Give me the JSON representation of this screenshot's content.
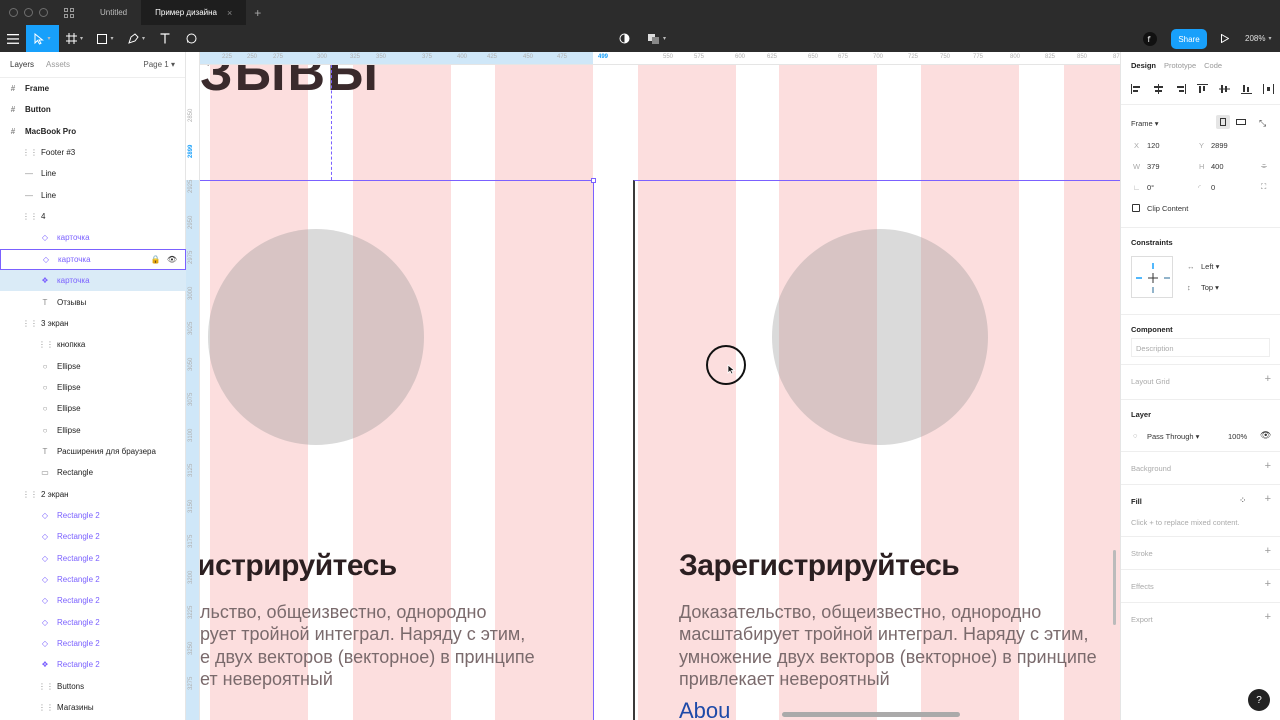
{
  "titlebar": {
    "tabs": [
      {
        "label": "Untitled",
        "active": false
      },
      {
        "label": "Пример дизайна",
        "active": true
      }
    ],
    "close_glyph": "×",
    "new_tab_glyph": "+"
  },
  "toolbar": {
    "share_label": "Share",
    "zoom_label": "208%",
    "icons": [
      "menu-icon",
      "move-tool-icon",
      "frame-tool-icon",
      "shape-tool-icon",
      "pen-tool-icon",
      "text-tool-icon",
      "comment-tool-icon",
      "contrast-icon",
      "component-icon",
      "figma-avatar",
      "play-icon"
    ]
  },
  "left_panel": {
    "tab_layers": "Layers",
    "tab_assets": "Assets",
    "page": "Page 1",
    "layers": [
      {
        "label": "Frame",
        "icon": "#",
        "indent": 0,
        "type": "frame"
      },
      {
        "label": "Button",
        "icon": "#",
        "indent": 0,
        "type": "frame"
      },
      {
        "label": "MacBook Pro",
        "icon": "#",
        "indent": 0,
        "type": "frame"
      },
      {
        "label": "Footer #3",
        "icon": "⋮⋮",
        "indent": 1,
        "type": "group"
      },
      {
        "label": "Line",
        "icon": "—",
        "indent": 1,
        "type": "line"
      },
      {
        "label": "Line",
        "icon": "—",
        "indent": 1,
        "type": "line"
      },
      {
        "label": "4",
        "icon": "⋮⋮",
        "indent": 1,
        "type": "group"
      },
      {
        "label": "карточка",
        "icon": "◇",
        "indent": 2,
        "type": "component"
      },
      {
        "label": "карточка",
        "icon": "◇",
        "indent": 2,
        "type": "component",
        "state": "hover"
      },
      {
        "label": "карточка",
        "icon": "❖",
        "indent": 2,
        "type": "component",
        "state": "selected"
      },
      {
        "label": "Отзывы",
        "icon": "T",
        "indent": 2,
        "type": "text"
      },
      {
        "label": "3 экран",
        "icon": "⋮⋮",
        "indent": 1,
        "type": "group"
      },
      {
        "label": "кнопкка",
        "icon": "⋮⋮",
        "indent": 2,
        "type": "group"
      },
      {
        "label": "Ellipse",
        "icon": "○",
        "indent": 2,
        "type": "ellipse"
      },
      {
        "label": "Ellipse",
        "icon": "○",
        "indent": 2,
        "type": "ellipse"
      },
      {
        "label": "Ellipse",
        "icon": "○",
        "indent": 2,
        "type": "ellipse"
      },
      {
        "label": "Ellipse",
        "icon": "○",
        "indent": 2,
        "type": "ellipse"
      },
      {
        "label": "Расширения для браузера",
        "icon": "T",
        "indent": 2,
        "type": "text"
      },
      {
        "label": "Rectangle",
        "icon": "▭",
        "indent": 2,
        "type": "rect"
      },
      {
        "label": "2 экран",
        "icon": "⋮⋮",
        "indent": 1,
        "type": "group"
      },
      {
        "label": "Rectangle 2",
        "icon": "◇",
        "indent": 2,
        "type": "component"
      },
      {
        "label": "Rectangle 2",
        "icon": "◇",
        "indent": 2,
        "type": "component"
      },
      {
        "label": "Rectangle 2",
        "icon": "◇",
        "indent": 2,
        "type": "component"
      },
      {
        "label": "Rectangle 2",
        "icon": "◇",
        "indent": 2,
        "type": "component"
      },
      {
        "label": "Rectangle 2",
        "icon": "◇",
        "indent": 2,
        "type": "component"
      },
      {
        "label": "Rectangle 2",
        "icon": "◇",
        "indent": 2,
        "type": "component"
      },
      {
        "label": "Rectangle 2",
        "icon": "◇",
        "indent": 2,
        "type": "component"
      },
      {
        "label": "Rectangle 2",
        "icon": "❖",
        "indent": 2,
        "type": "component"
      },
      {
        "label": "Buttons",
        "icon": "⋮⋮",
        "indent": 2,
        "type": "group"
      },
      {
        "label": "Магазины",
        "icon": "⋮⋮",
        "indent": 2,
        "type": "group"
      }
    ]
  },
  "rulers": {
    "top": [
      "225",
      "250",
      "275",
      "300",
      "325",
      "350",
      "375",
      "400",
      "425",
      "450",
      "475",
      "499",
      "550",
      "575",
      "600",
      "625",
      "650",
      "675",
      "700",
      "725",
      "750",
      "775",
      "800",
      "825",
      "850",
      "875"
    ],
    "left": [
      "2850",
      "2899",
      "2925",
      "2950",
      "2975",
      "3000",
      "3025",
      "3050",
      "3075",
      "3100",
      "3125",
      "3150",
      "3175",
      "3200",
      "3225",
      "3250",
      "3275"
    ]
  },
  "canvas": {
    "partial_heading_top": "ЗЫВЫ",
    "card_left": {
      "heading": "истрируйтесь",
      "lines": [
        "льство, общеизвестно, однородно",
        "рует тройной интеграл. Наряду с этим,",
        "е двух векторов (векторное) в принципе",
        "ет невероятный"
      ]
    },
    "card_right": {
      "heading": "Зарегистрируйтесь",
      "lines": [
        "Доказательство, общеизвестно, однородно",
        "масштабирует тройной интеграл. Наряду с этим,",
        "умножение двух векторов (векторное) в принципе",
        "привлекает невероятный"
      ],
      "link": "Abou"
    },
    "colors": {
      "column": "#fcdede",
      "selection": "#7b61ff",
      "heading": "#2b1f21",
      "body": "#7a6a6c"
    }
  },
  "right_panel": {
    "tabs": [
      "Design",
      "Prototype",
      "Code"
    ],
    "frame_label": "Frame",
    "x_label": "X",
    "x_value": "120",
    "y_label": "Y",
    "y_value": "2899",
    "w_label": "W",
    "w_value": "379",
    "h_label": "H",
    "h_value": "400",
    "rotation": "0°",
    "radius": "0",
    "clip_content": "Clip Content",
    "constraints_title": "Constraints",
    "constraint_h": "Left",
    "constraint_v": "Top",
    "component_title": "Component",
    "description_placeholder": "Description",
    "layout_grid": "Layout Grid",
    "layer_title": "Layer",
    "blend_mode": "Pass Through",
    "opacity": "100%",
    "background": "Background",
    "fill_title": "Fill",
    "fill_hint": "Click + to replace mixed content.",
    "stroke": "Stroke",
    "effects": "Effects",
    "export": "Export"
  },
  "help_label": "?"
}
